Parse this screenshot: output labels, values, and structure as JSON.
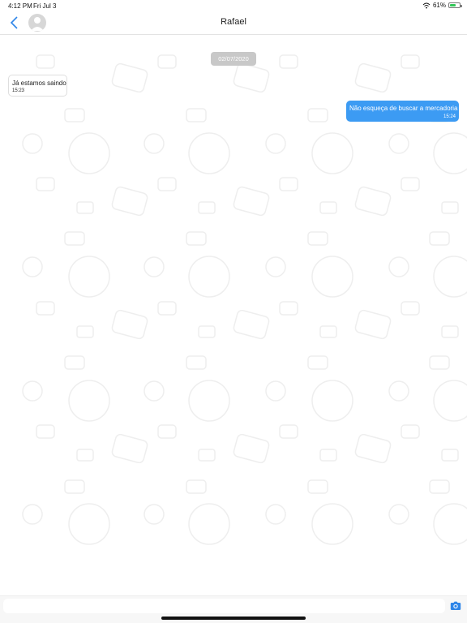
{
  "status_bar": {
    "time": "4:12 PM",
    "date": "Fri Jul 3",
    "battery": "61%",
    "battery_level": 0.61,
    "icons": [
      "wifi-icon",
      "battery-icon"
    ]
  },
  "header": {
    "title": "Rafael",
    "back_icon": "chevron-left-icon",
    "avatar_icon": "avatar-placeholder-icon"
  },
  "chat": {
    "date_chip": "02/07/2020",
    "messages": [
      {
        "direction": "incoming",
        "text": "Já estamos saindo",
        "time": "15:23"
      },
      {
        "direction": "outgoing",
        "text": "Não esqueça de buscar a mercadoria",
        "time": "15:24"
      }
    ]
  },
  "composer": {
    "value": "",
    "placeholder": "",
    "camera_icon": "camera-icon"
  },
  "colors": {
    "accent": "#3c9bf3",
    "incoming_bubble": "#ffffff",
    "outgoing_bubble": "#3c9bf3",
    "date_chip": "#c8c8c8",
    "battery": "#33c759"
  }
}
